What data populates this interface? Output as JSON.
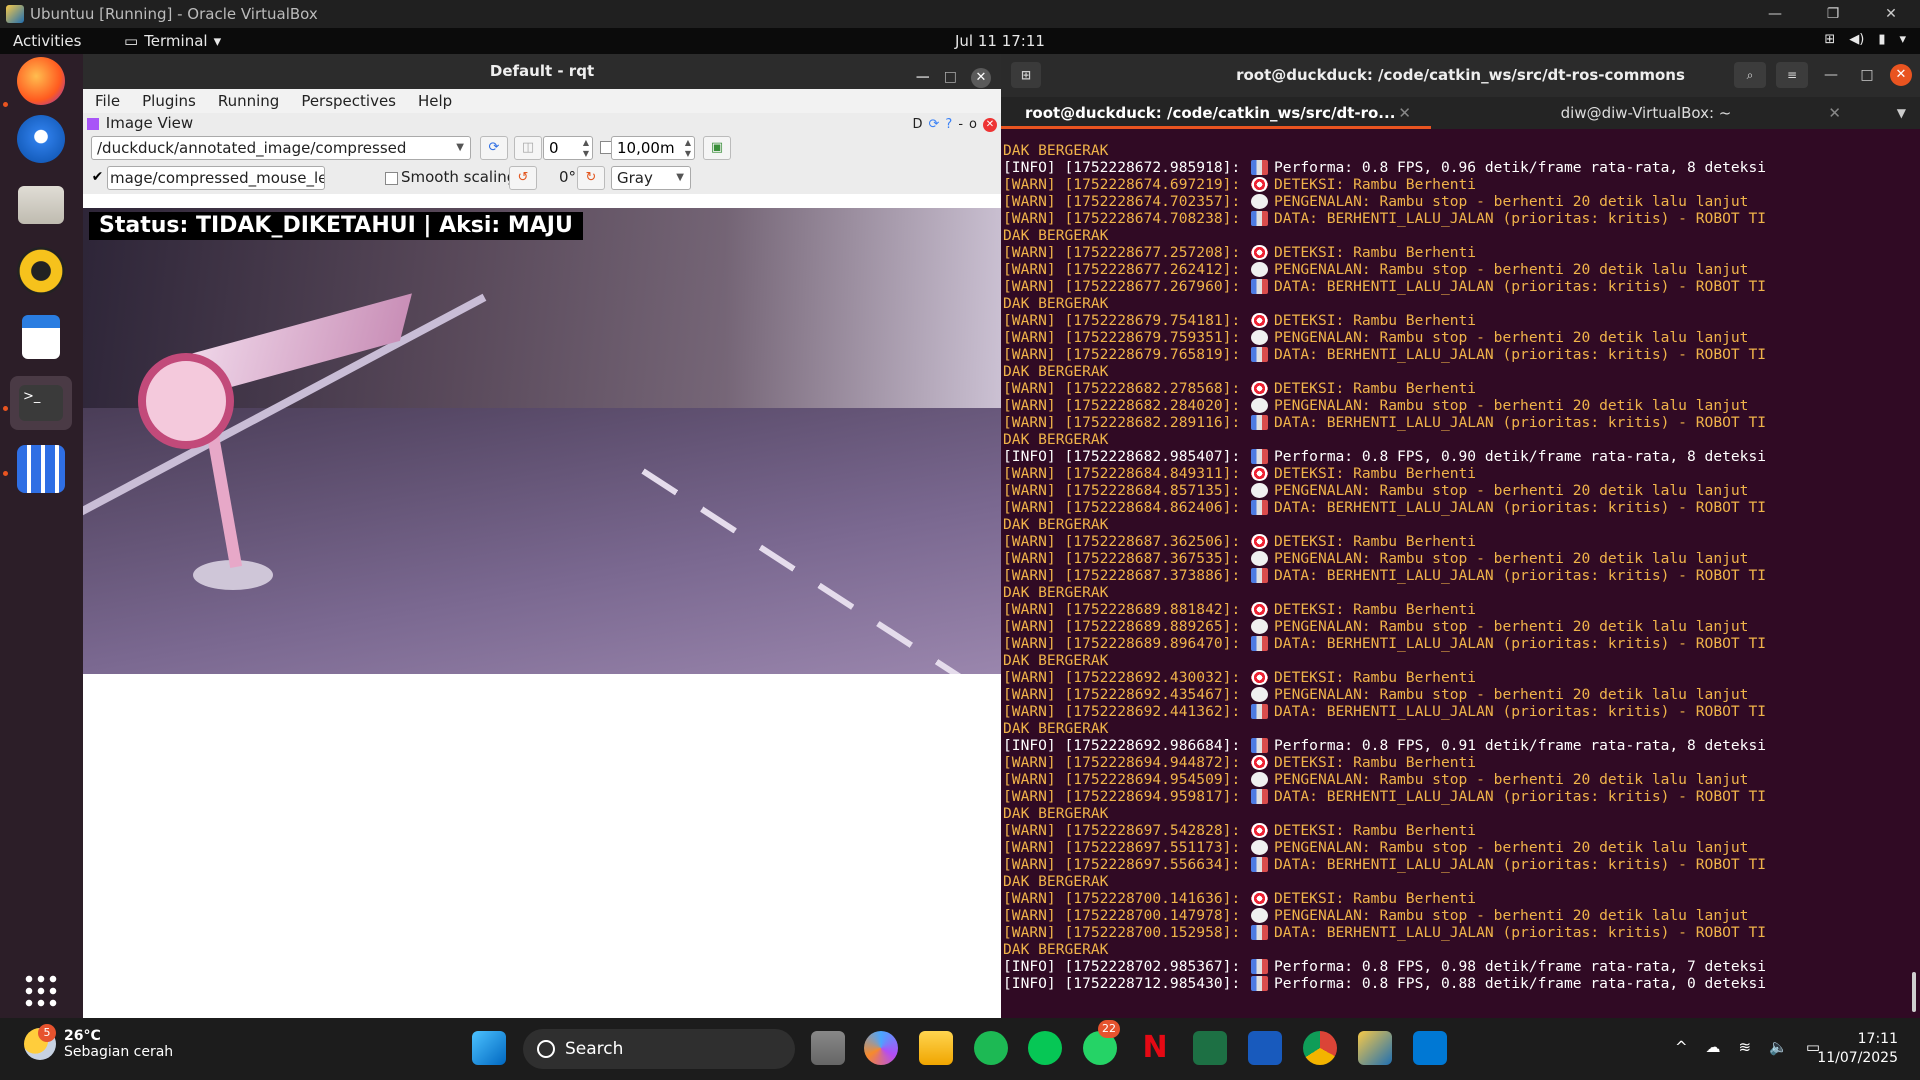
{
  "vbox": {
    "title": "Ubuntuu [Running] - Oracle VirtualBox",
    "min": "—",
    "restore": "❐",
    "close": "✕"
  },
  "gnome": {
    "activities": "Activities",
    "app": "Terminal",
    "clock": "Jul 11  17:11"
  },
  "dock": {
    "items": [
      "firefox-icon",
      "thunderbird-icon",
      "files-icon",
      "rhythmbox-icon",
      "writer-icon",
      "terminal-icon",
      "apps-icon"
    ],
    "show_apps": "show-applications-icon"
  },
  "rqt": {
    "title": "Default - rqt",
    "menu": [
      "File",
      "Plugins",
      "Running",
      "Perspectives",
      "Help"
    ],
    "image_view_title": "Image View",
    "ivctl": "D",
    "topic": "/duckduck/annotated_image/compressed",
    "spin_value": "0",
    "max_range": "10,00m",
    "mouse_topic": "mage/compressed_mouse_left",
    "smooth_scaling": "Smooth scaling",
    "rotation": "0°",
    "color_scheme": "Gray",
    "overlay": "Status: TIDAK_DIKETAHUI | Aksi: MAJU"
  },
  "terminal": {
    "title": "root@duckduck: /code/catkin_ws/src/dt-ros-commons",
    "tabs": [
      "root@duckduck: /code/catkin_ws/src/dt-ro...",
      "diw@diw-VirtualBox: ~"
    ],
    "lines": [
      {
        "t": "warn",
        "text": "DAK BERGERAK",
        "e": ""
      },
      {
        "t": "info",
        "text": "[INFO] [1752228672.985918]: ",
        "e": "chart",
        "msg": "Performa: 0.8 FPS, 0.96 detik/frame rata-rata, 8 deteksi"
      },
      {
        "t": "warn",
        "text": "[WARN] [1752228674.697219]: ",
        "e": "target",
        "msg": "DETEKSI: Rambu Berhenti"
      },
      {
        "t": "warn",
        "text": "[WARN] [1752228674.702357]: ",
        "e": "bubble",
        "msg": "PENGENALAN: Rambu stop - berhenti 20 detik lalu lanjut"
      },
      {
        "t": "warn",
        "text": "[WARN] [1752228674.708238]: ",
        "e": "chart",
        "msg": "DATA: BERHENTI_LALU_JALAN (prioritas: kritis) - ROBOT TI"
      },
      {
        "t": "warn",
        "text": "DAK BERGERAK",
        "e": ""
      },
      {
        "t": "warn",
        "text": "[WARN] [1752228677.257208]: ",
        "e": "target",
        "msg": "DETEKSI: Rambu Berhenti"
      },
      {
        "t": "warn",
        "text": "[WARN] [1752228677.262412]: ",
        "e": "bubble",
        "msg": "PENGENALAN: Rambu stop - berhenti 20 detik lalu lanjut"
      },
      {
        "t": "warn",
        "text": "[WARN] [1752228677.267960]: ",
        "e": "chart",
        "msg": "DATA: BERHENTI_LALU_JALAN (prioritas: kritis) - ROBOT TI"
      },
      {
        "t": "warn",
        "text": "DAK BERGERAK",
        "e": ""
      },
      {
        "t": "warn",
        "text": "[WARN] [1752228679.754181]: ",
        "e": "target",
        "msg": "DETEKSI: Rambu Berhenti"
      },
      {
        "t": "warn",
        "text": "[WARN] [1752228679.759351]: ",
        "e": "bubble",
        "msg": "PENGENALAN: Rambu stop - berhenti 20 detik lalu lanjut"
      },
      {
        "t": "warn",
        "text": "[WARN] [1752228679.765819]: ",
        "e": "chart",
        "msg": "DATA: BERHENTI_LALU_JALAN (prioritas: kritis) - ROBOT TI"
      },
      {
        "t": "warn",
        "text": "DAK BERGERAK",
        "e": ""
      },
      {
        "t": "warn",
        "text": "[WARN] [1752228682.278568]: ",
        "e": "target",
        "msg": "DETEKSI: Rambu Berhenti"
      },
      {
        "t": "warn",
        "text": "[WARN] [1752228682.284020]: ",
        "e": "bubble",
        "msg": "PENGENALAN: Rambu stop - berhenti 20 detik lalu lanjut"
      },
      {
        "t": "warn",
        "text": "[WARN] [1752228682.289116]: ",
        "e": "chart",
        "msg": "DATA: BERHENTI_LALU_JALAN (prioritas: kritis) - ROBOT TI"
      },
      {
        "t": "warn",
        "text": "DAK BERGERAK",
        "e": ""
      },
      {
        "t": "info",
        "text": "[INFO] [1752228682.985407]: ",
        "e": "chart",
        "msg": "Performa: 0.8 FPS, 0.90 detik/frame rata-rata, 8 deteksi"
      },
      {
        "t": "warn",
        "text": "[WARN] [1752228684.849311]: ",
        "e": "target",
        "msg": "DETEKSI: Rambu Berhenti"
      },
      {
        "t": "warn",
        "text": "[WARN] [1752228684.857135]: ",
        "e": "bubble",
        "msg": "PENGENALAN: Rambu stop - berhenti 20 detik lalu lanjut"
      },
      {
        "t": "warn",
        "text": "[WARN] [1752228684.862406]: ",
        "e": "chart",
        "msg": "DATA: BERHENTI_LALU_JALAN (prioritas: kritis) - ROBOT TI"
      },
      {
        "t": "warn",
        "text": "DAK BERGERAK",
        "e": ""
      },
      {
        "t": "warn",
        "text": "[WARN] [1752228687.362506]: ",
        "e": "target",
        "msg": "DETEKSI: Rambu Berhenti"
      },
      {
        "t": "warn",
        "text": "[WARN] [1752228687.367535]: ",
        "e": "bubble",
        "msg": "PENGENALAN: Rambu stop - berhenti 20 detik lalu lanjut"
      },
      {
        "t": "warn",
        "text": "[WARN] [1752228687.373886]: ",
        "e": "chart",
        "msg": "DATA: BERHENTI_LALU_JALAN (prioritas: kritis) - ROBOT TI"
      },
      {
        "t": "warn",
        "text": "DAK BERGERAK",
        "e": ""
      },
      {
        "t": "warn",
        "text": "[WARN] [1752228689.881842]: ",
        "e": "target",
        "msg": "DETEKSI: Rambu Berhenti"
      },
      {
        "t": "warn",
        "text": "[WARN] [1752228689.889265]: ",
        "e": "bubble",
        "msg": "PENGENALAN: Rambu stop - berhenti 20 detik lalu lanjut"
      },
      {
        "t": "warn",
        "text": "[WARN] [1752228689.896470]: ",
        "e": "chart",
        "msg": "DATA: BERHENTI_LALU_JALAN (prioritas: kritis) - ROBOT TI"
      },
      {
        "t": "warn",
        "text": "DAK BERGERAK",
        "e": ""
      },
      {
        "t": "warn",
        "text": "[WARN] [1752228692.430032]: ",
        "e": "target",
        "msg": "DETEKSI: Rambu Berhenti"
      },
      {
        "t": "warn",
        "text": "[WARN] [1752228692.435467]: ",
        "e": "bubble",
        "msg": "PENGENALAN: Rambu stop - berhenti 20 detik lalu lanjut"
      },
      {
        "t": "warn",
        "text": "[WARN] [1752228692.441362]: ",
        "e": "chart",
        "msg": "DATA: BERHENTI_LALU_JALAN (prioritas: kritis) - ROBOT TI"
      },
      {
        "t": "warn",
        "text": "DAK BERGERAK",
        "e": ""
      },
      {
        "t": "info",
        "text": "[INFO] [1752228692.986684]: ",
        "e": "chart",
        "msg": "Performa: 0.8 FPS, 0.91 detik/frame rata-rata, 8 deteksi"
      },
      {
        "t": "warn",
        "text": "[WARN] [1752228694.944872]: ",
        "e": "target",
        "msg": "DETEKSI: Rambu Berhenti"
      },
      {
        "t": "warn",
        "text": "[WARN] [1752228694.954509]: ",
        "e": "bubble",
        "msg": "PENGENALAN: Rambu stop - berhenti 20 detik lalu lanjut"
      },
      {
        "t": "warn",
        "text": "[WARN] [1752228694.959817]: ",
        "e": "chart",
        "msg": "DATA: BERHENTI_LALU_JALAN (prioritas: kritis) - ROBOT TI"
      },
      {
        "t": "warn",
        "text": "DAK BERGERAK",
        "e": ""
      },
      {
        "t": "warn",
        "text": "[WARN] [1752228697.542828]: ",
        "e": "target",
        "msg": "DETEKSI: Rambu Berhenti"
      },
      {
        "t": "warn",
        "text": "[WARN] [1752228697.551173]: ",
        "e": "bubble",
        "msg": "PENGENALAN: Rambu stop - berhenti 20 detik lalu lanjut"
      },
      {
        "t": "warn",
        "text": "[WARN] [1752228697.556634]: ",
        "e": "chart",
        "msg": "DATA: BERHENTI_LALU_JALAN (prioritas: kritis) - ROBOT TI"
      },
      {
        "t": "warn",
        "text": "DAK BERGERAK",
        "e": ""
      },
      {
        "t": "warn",
        "text": "[WARN] [1752228700.141636]: ",
        "e": "target",
        "msg": "DETEKSI: Rambu Berhenti"
      },
      {
        "t": "warn",
        "text": "[WARN] [1752228700.147978]: ",
        "e": "bubble",
        "msg": "PENGENALAN: Rambu stop - berhenti 20 detik lalu lanjut"
      },
      {
        "t": "warn",
        "text": "[WARN] [1752228700.152958]: ",
        "e": "chart",
        "msg": "DATA: BERHENTI_LALU_JALAN (prioritas: kritis) - ROBOT TI"
      },
      {
        "t": "warn",
        "text": "DAK BERGERAK",
        "e": ""
      },
      {
        "t": "info",
        "text": "[INFO] [1752228702.985367]: ",
        "e": "chart",
        "msg": "Performa: 0.8 FPS, 0.98 detik/frame rata-rata, 7 deteksi"
      },
      {
        "t": "info",
        "text": "[INFO] [1752228712.985430]: ",
        "e": "chart",
        "msg": "Performa: 0.8 FPS, 0.88 detik/frame rata-rata, 0 deteksi"
      }
    ]
  },
  "taskbar": {
    "temp": "26°C",
    "weather": "Sebagian cerah",
    "weather_badge": "5",
    "search": "Search",
    "whatsapp_badge": "22",
    "time": "17:11",
    "date": "11/07/2025",
    "colors": {
      "accent": "#e95420",
      "terminal_bg": "#300a24",
      "warn": "#f0b34a"
    }
  }
}
